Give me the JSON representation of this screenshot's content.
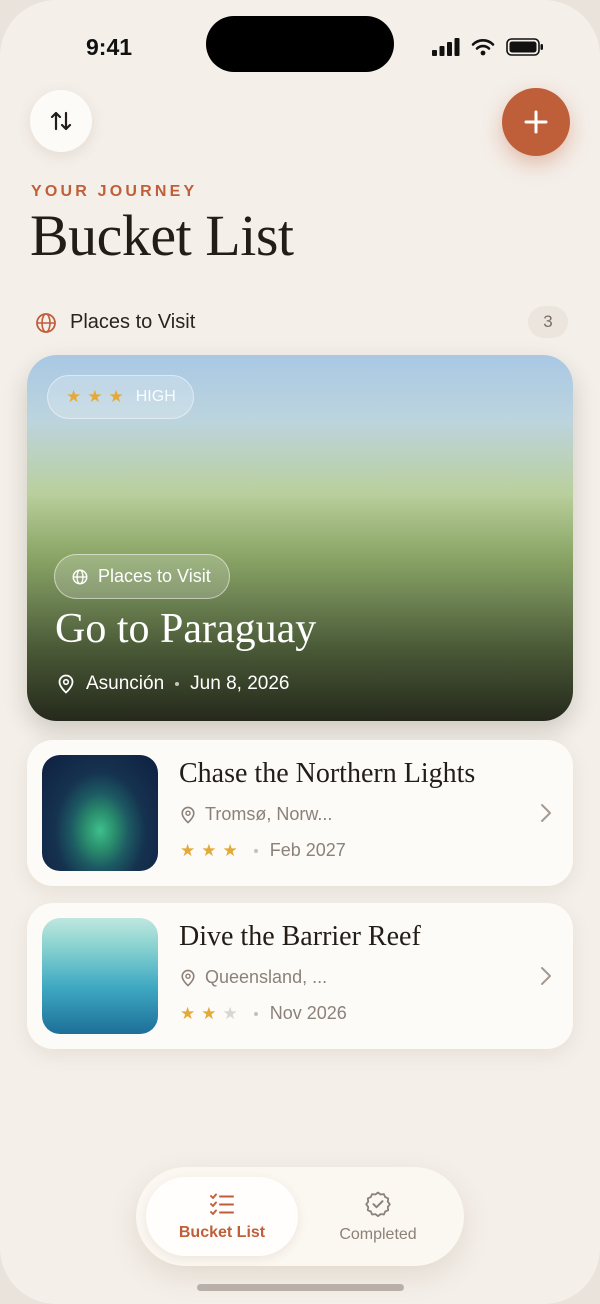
{
  "status": {
    "time": "9:41"
  },
  "header": {
    "eyebrow": "YOUR JOURNEY",
    "title": "Bucket List",
    "sort_icon": "sort-arrows-icon",
    "add_icon": "plus-icon"
  },
  "section": {
    "label": "Places to Visit",
    "count": "3",
    "icon": "globe-icon"
  },
  "featured": {
    "priority": "HIGH",
    "stars": 3,
    "category": "Places to Visit",
    "title": "Go to Paraguay",
    "location": "Asunción",
    "date": "Jun 8, 2026"
  },
  "items": [
    {
      "title": "Chase the Northern Lights",
      "location": "Tromsø, Norw...",
      "stars": 3,
      "date": "Feb 2027"
    },
    {
      "title": "Dive the Barrier Reef",
      "location": "Queensland, ...",
      "stars": 2,
      "date": "Nov 2026"
    }
  ],
  "nav": {
    "tabs": [
      {
        "label": "Bucket List",
        "icon": "checklist-icon",
        "active": true
      },
      {
        "label": "Completed",
        "icon": "verified-badge-icon",
        "active": false
      }
    ]
  },
  "colors": {
    "accent": "#bf5f3a",
    "background": "#f4efe9",
    "star": "#e3aa3a"
  }
}
